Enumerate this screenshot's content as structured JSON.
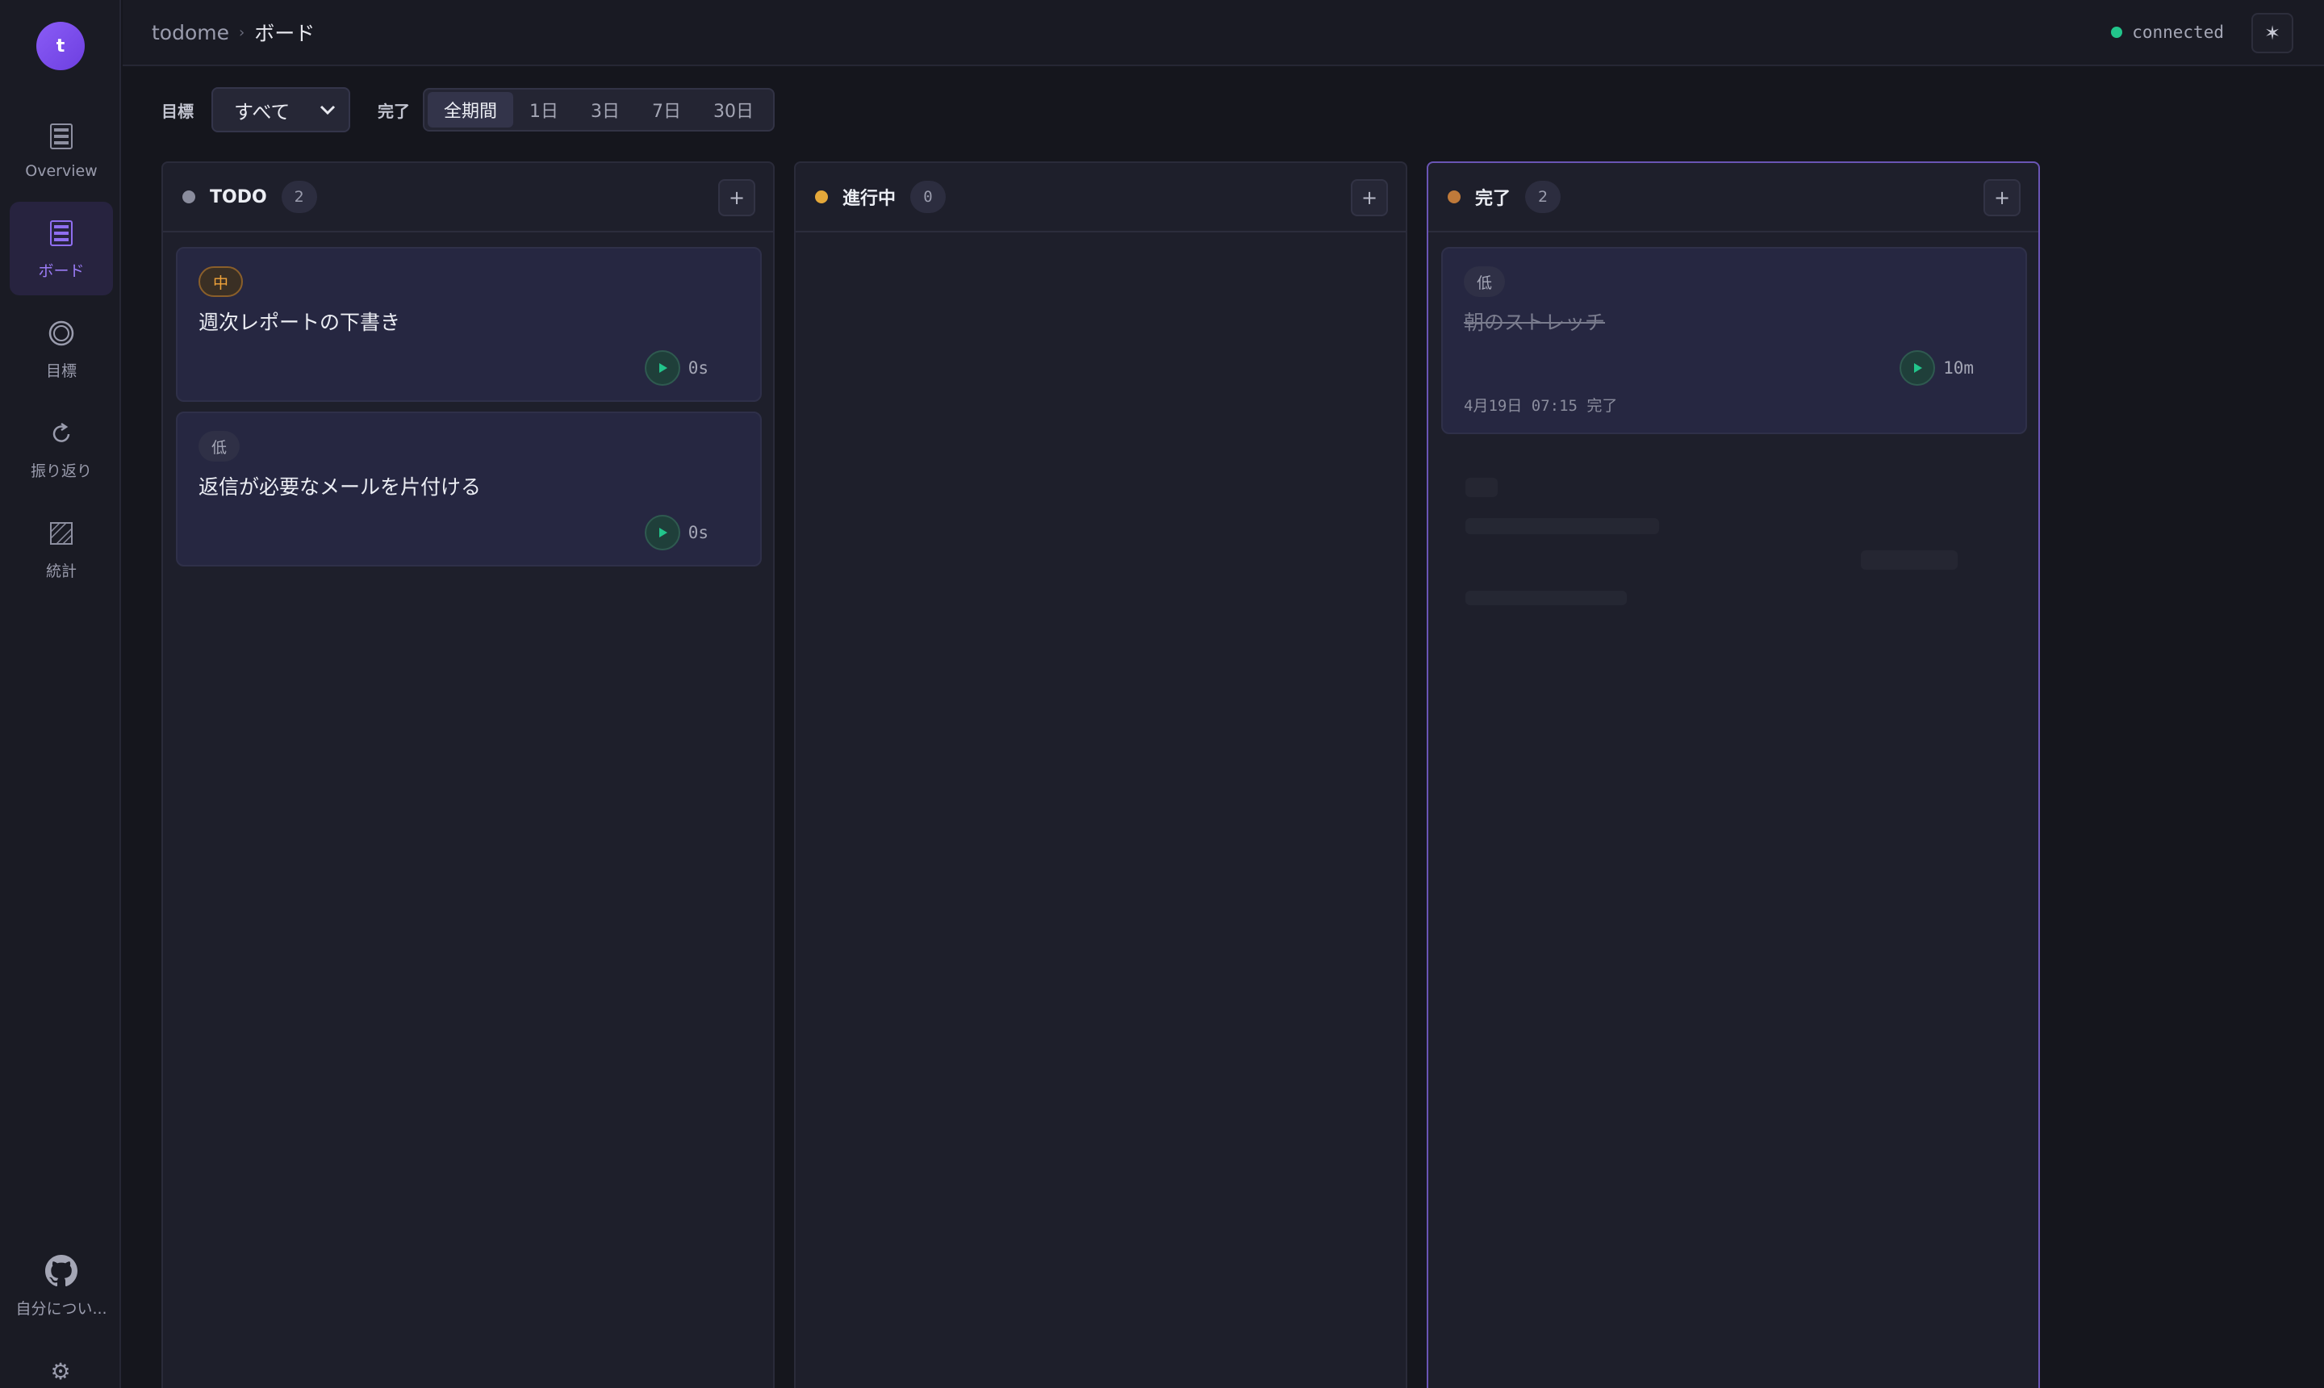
{
  "user": {
    "avatar_letter": "t"
  },
  "sidebar": {
    "items": [
      {
        "label": "Overview",
        "icon": "grid-icon"
      },
      {
        "label": "ボード",
        "icon": "board-icon",
        "active": true
      },
      {
        "label": "目標",
        "icon": "target-icon"
      },
      {
        "label": "振り返り",
        "icon": "refresh-icon"
      },
      {
        "label": "統計",
        "icon": "stats-icon"
      }
    ],
    "about": {
      "label": "自分につい...",
      "icon": "github-icon"
    },
    "settings_icon": "gear-icon"
  },
  "header": {
    "app_name": "todome",
    "separator": "›",
    "page": "ボード",
    "status": "connected",
    "status_color": "#22c58b",
    "theme_toggle_icon": "sun-icon"
  },
  "filters": {
    "goal_label": "目標",
    "goal_value": "すべて",
    "done_label": "完了",
    "ranges": [
      "全期間",
      "1日",
      "3日",
      "7日",
      "30日"
    ],
    "active_range": "全期間"
  },
  "columns": [
    {
      "title": "TODO",
      "count": "2",
      "dot_color": "#8a8c9d",
      "add_label": "+",
      "cards": [
        {
          "priority": "中",
          "title": "週次レポートの下書き",
          "time": "0s"
        },
        {
          "priority": "低",
          "title": "返信が必要なメールを片付ける",
          "time": "0s"
        }
      ]
    },
    {
      "title": "進行中",
      "count": "0",
      "dot_color": "#e5a83a",
      "add_label": "+",
      "cards": []
    },
    {
      "title": "完了",
      "count": "2",
      "dot_color": "#c07a3a",
      "add_label": "+",
      "cards": [
        {
          "priority": "低",
          "title": "朝のストレッチ",
          "time": "10m",
          "completed_at": "4月19日 07:15 完了"
        }
      ]
    }
  ]
}
